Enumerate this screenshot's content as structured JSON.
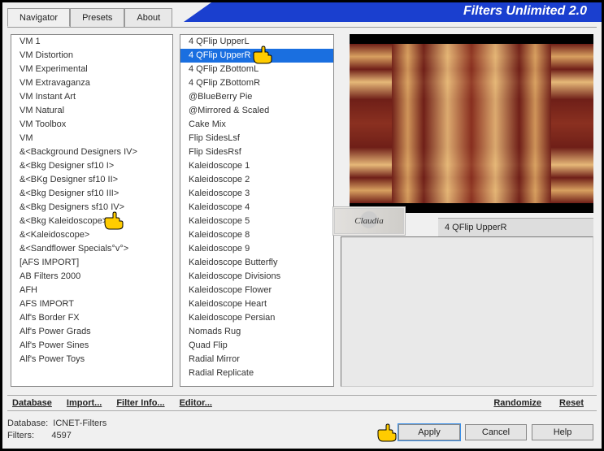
{
  "title": "Filters Unlimited 2.0",
  "tabs": [
    "Navigator",
    "Presets",
    "About"
  ],
  "active_tab": 0,
  "list_categories": [
    "VM 1",
    "VM Distortion",
    "VM Experimental",
    "VM Extravaganza",
    "VM Instant Art",
    "VM Natural",
    "VM Toolbox",
    "VM",
    "&<Background Designers IV>",
    "&<Bkg Designer sf10 I>",
    "&<BKg Designer sf10 II>",
    "&<Bkg Designer sf10 III>",
    "&<Bkg Designers sf10 IV>",
    "&<Bkg Kaleidoscope>",
    "&<Kaleidoscope>",
    "&<Sandflower Specials°v°>",
    "[AFS IMPORT]",
    "AB Filters 2000",
    "AFH",
    "AFS IMPORT",
    "Alf's Border FX",
    "Alf's Power Grads",
    "Alf's Power Sines",
    "Alf's Power Toys"
  ],
  "category_pointer_index": 13,
  "list_filters": [
    "4 QFlip UpperL",
    "4 QFlip UpperR",
    "4 QFlip ZBottomL",
    "4 QFlip ZBottomR",
    "@BlueBerry Pie",
    "@Mirrored & Scaled",
    "Cake Mix",
    "Flip SidesLsf",
    "Flip SidesRsf",
    "Kaleidoscope 1",
    "Kaleidoscope 2",
    "Kaleidoscope 3",
    "Kaleidoscope 4",
    "Kaleidoscope 5",
    "Kaleidoscope 8",
    "Kaleidoscope 9",
    "Kaleidoscope Butterfly",
    "Kaleidoscope Divisions",
    "Kaleidoscope Flower",
    "Kaleidoscope Heart",
    "Kaleidoscope Persian",
    "Nomads Rug",
    "Quad Flip",
    "Radial Mirror",
    "Radial Replicate"
  ],
  "filter_selected_index": 1,
  "filter_pointer_index": 1,
  "preview_label": "4 QFlip UpperR",
  "stamp_text": "Claudia",
  "toolbar": {
    "database": "Database",
    "import": "Import...",
    "filter_info": "Filter Info...",
    "editor": "Editor...",
    "randomize": "Randomize",
    "reset": "Reset"
  },
  "status": {
    "db_label": "Database:",
    "db_value": "ICNET-Filters",
    "flt_label": "Filters:",
    "flt_value": "4597"
  },
  "buttons": {
    "apply": "Apply",
    "cancel": "Cancel",
    "help": "Help"
  },
  "apply_pointer": true
}
